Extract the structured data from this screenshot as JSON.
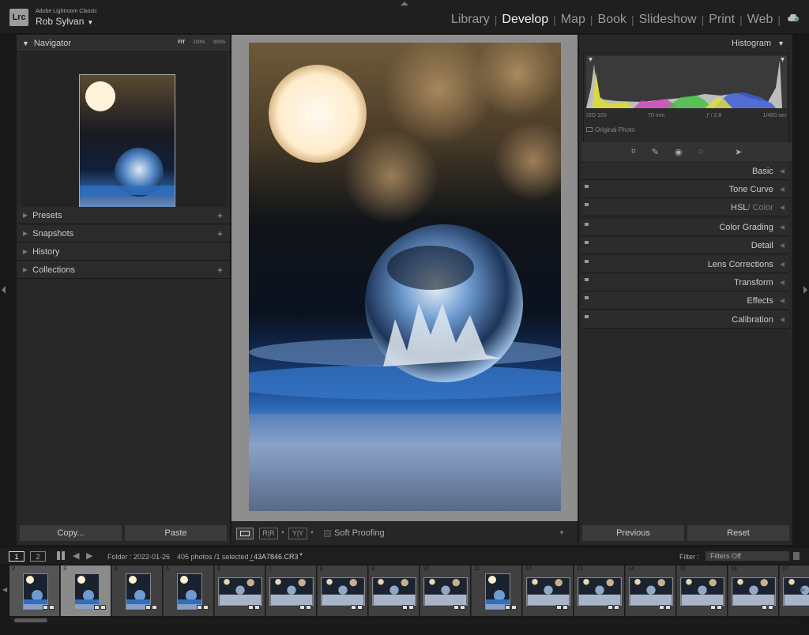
{
  "app": {
    "logo": "Lrc",
    "name": "Adobe Lightroom Classic",
    "user": "Rob Sylvan",
    "user_arrow": "▼"
  },
  "modules": [
    "Library",
    "Develop",
    "Map",
    "Book",
    "Slideshow",
    "Print",
    "Web"
  ],
  "active_module": "Develop",
  "navigator": {
    "title": "Navigator",
    "zoom": [
      "FIT",
      "100%",
      "300%"
    ]
  },
  "left_panels": [
    "Presets",
    "Snapshots",
    "History",
    "Collections"
  ],
  "left_buttons": {
    "copy": "Copy...",
    "paste": "Paste"
  },
  "histogram": {
    "title": "Histogram",
    "iso": "ISO 100",
    "focal": "70 mm",
    "aperture": "ƒ / 2.8",
    "shutter": "1/400 sec",
    "original": "Original Photo"
  },
  "right_panels": [
    {
      "label": "Basic",
      "sub": ""
    },
    {
      "label": "Tone Curve",
      "sub": ""
    },
    {
      "label": "HSL",
      "sub": " / Color"
    },
    {
      "label": "Color Grading",
      "sub": ""
    },
    {
      "label": "Detail",
      "sub": ""
    },
    {
      "label": "Lens Corrections",
      "sub": ""
    },
    {
      "label": "Transform",
      "sub": ""
    },
    {
      "label": "Effects",
      "sub": ""
    },
    {
      "label": "Calibration",
      "sub": ""
    }
  ],
  "right_buttons": {
    "previous": "Previous",
    "reset": "Reset"
  },
  "toolbar": {
    "soft_proofing": "Soft Proofing",
    "ry1": "R|R",
    "ry2": "Y|Y"
  },
  "filmbar": {
    "page1": "1",
    "page2": "2",
    "folder": "Folder : 2022-01-26",
    "count": "405 photos /1 selected /",
    "file": "_43A7846.CR3",
    "filter_label": "Filter :",
    "filter_value": "Filters Off"
  },
  "film_cells": [
    {
      "num": "2",
      "portrait": true
    },
    {
      "num": "3",
      "portrait": true
    },
    {
      "num": "4",
      "portrait": true
    },
    {
      "num": "5",
      "portrait": true
    },
    {
      "num": "6",
      "portrait": false
    },
    {
      "num": "7",
      "portrait": false
    },
    {
      "num": "8",
      "portrait": false
    },
    {
      "num": "9",
      "portrait": false
    },
    {
      "num": "10",
      "portrait": false
    },
    {
      "num": "11",
      "portrait": true
    },
    {
      "num": "12",
      "portrait": false
    },
    {
      "num": "13",
      "portrait": false
    },
    {
      "num": "14",
      "portrait": false
    },
    {
      "num": "15",
      "portrait": false
    },
    {
      "num": "16",
      "portrait": false
    },
    {
      "num": "17",
      "portrait": false
    }
  ],
  "colors": {
    "accent": "#f0f0f0",
    "panel": "#282828",
    "background": "#181818"
  }
}
